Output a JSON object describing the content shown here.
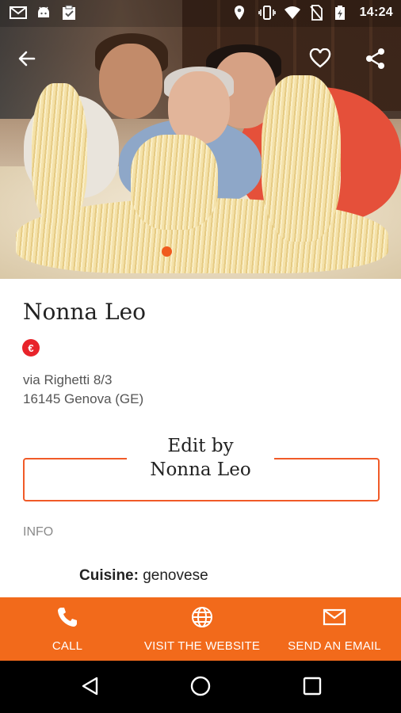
{
  "status_bar": {
    "time": "14:24",
    "icons": [
      "gmail-icon",
      "android-icon",
      "clipboard-icon",
      "location-icon",
      "vibrate-icon",
      "wifi-icon",
      "no-sim-icon",
      "battery-charging-icon"
    ]
  },
  "toolbar": {
    "back_icon": "arrow-left-icon",
    "favorite_icon": "heart-outline-icon",
    "share_icon": "share-icon"
  },
  "gallery": {
    "current_page_index": 1
  },
  "restaurant": {
    "name": "Nonna Leo",
    "price_symbol": "€",
    "address_line1": "via Righetti 8/3",
    "address_line2": "16145 Genova (GE)"
  },
  "edit": {
    "label_line1": "Edit by",
    "label_line2": "Nonna Leo"
  },
  "info": {
    "heading": "INFO",
    "cuisine_label": "Cuisine:",
    "cuisine_value": "genovese"
  },
  "actions": {
    "call": "CALL",
    "website": "VISIT THE WEBSITE",
    "email": "SEND AN EMAIL"
  },
  "colors": {
    "accent": "#f26a1b",
    "badge_red": "#e8232a",
    "border_orange": "#f05a28"
  }
}
